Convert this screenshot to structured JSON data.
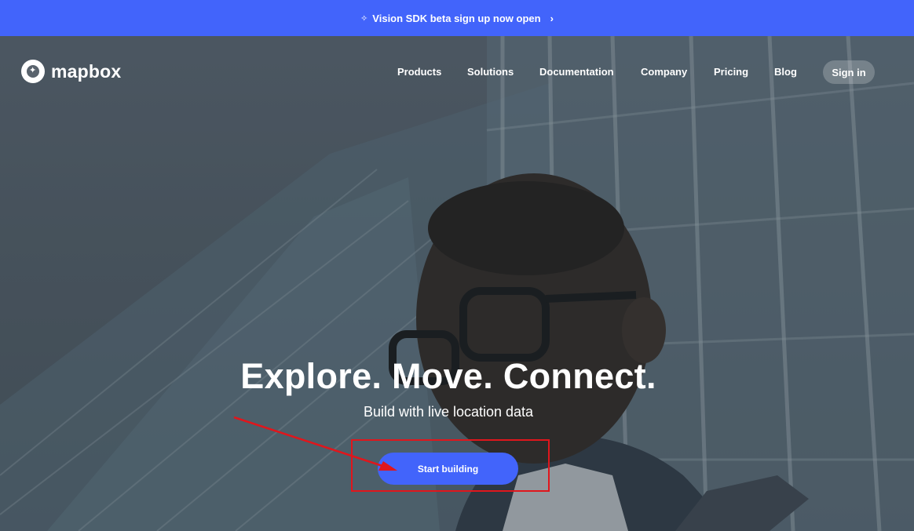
{
  "banner": {
    "icon": "sparkle-icon",
    "text": "Vision SDK beta sign up now open",
    "chevron_icon": "chevron-right-icon",
    "color": "#4264fb"
  },
  "header": {
    "logo_text": "mapbox",
    "logo_icon": "mapbox-logo-icon",
    "nav": [
      "Products",
      "Solutions",
      "Documentation",
      "Company",
      "Pricing",
      "Blog"
    ],
    "signin_label": "Sign in"
  },
  "hero": {
    "headline": "Explore. Move. Connect.",
    "subheadline": "Build with live location data",
    "cta_label": "Start building",
    "cta_color": "#4264fb"
  },
  "annotation": {
    "color": "#e0161c",
    "type": "red arrow and rectangle highlighting the call-to-action button"
  }
}
